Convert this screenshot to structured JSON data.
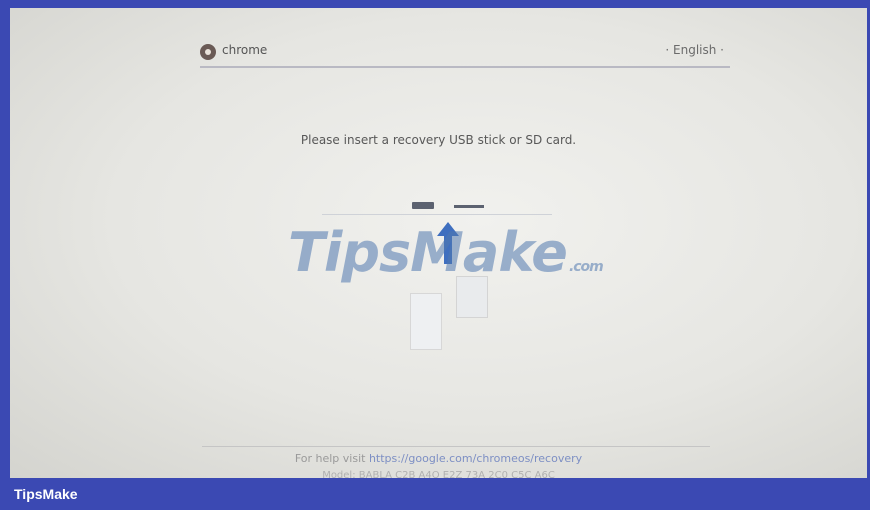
{
  "header": {
    "brand": "chrome",
    "language": "· English ·"
  },
  "message": "Please insert a recovery USB stick or SD card.",
  "help": {
    "prefix": "For help visit ",
    "link": "https://google.com/chromeos/recovery"
  },
  "model": "Model: BABLA C2B A4O E2Z 73A 2C0 C5C A6C",
  "watermark": {
    "text": "TipsMake",
    "suffix": ".com"
  },
  "footer": {
    "label": "TipsMake"
  },
  "colors": {
    "background": "#3b49b3",
    "screen": "#e9e9e6",
    "link": "#7d8fc4",
    "arrow": "#3f6fbf"
  },
  "icons": [
    "chrome-logo-icon",
    "usb-stick-icon",
    "sd-card-icon",
    "up-arrow-icon"
  ]
}
